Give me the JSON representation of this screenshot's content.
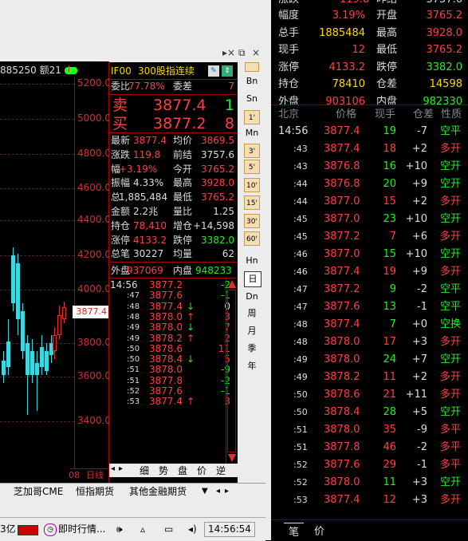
{
  "window": {
    "title_fragment": "885250 额21"
  },
  "chart": {
    "y_ticks": [
      "5200.0",
      "5000.0",
      "4800.0",
      "4600.0",
      "4400.0",
      "4200.0",
      "4000.0",
      "3800.0",
      "3600.0",
      "3400.0"
    ],
    "last_price_tag": "3877.4",
    "bottom_label": "08",
    "bottom_label2": "日线"
  },
  "quote": {
    "code": "IF00",
    "name": "300股指连续",
    "weibi_label": "委比",
    "weibi": "77.78%",
    "weicha_label": "委差",
    "weicha": "7",
    "sell_label": "卖",
    "sell_price": "3877.4",
    "sell_qty": "1",
    "buy_label": "买",
    "buy_price": "3877.2",
    "buy_qty": "8",
    "rows": [
      {
        "l1": "最新",
        "v1": "3877.4",
        "l2": "均价",
        "v2": "3869.5"
      },
      {
        "l1": "涨跌",
        "v1": "119.8",
        "l2": "前结",
        "v2": "3757.6"
      },
      {
        "l1": "幅",
        "v1": "+3.19%",
        "l2": "今开",
        "v2": "3765.2"
      },
      {
        "l1": "振幅",
        "v1": "4.33%",
        "l2": "最高",
        "v2": "3928.0"
      },
      {
        "l1": "总",
        "v1": "1,885,484",
        "l2": "最低",
        "v2": "3765.2"
      },
      {
        "l1": "金额",
        "v1": "2.2兆",
        "l2": "量比",
        "v2": "1.25"
      },
      {
        "l1": "持仓",
        "v1": "78,410",
        "l2": "增仓",
        "v2": "+14,598"
      },
      {
        "l1": "涨停",
        "v1": "4133.2",
        "l2": "跌停",
        "v2": "3382.0"
      },
      {
        "l1": "总笔",
        "v1": "30227",
        "l2": "均量",
        "v2": "62"
      }
    ],
    "outer_label": "外盘",
    "outer": "937069",
    "inner_label": "内盘",
    "inner": "948233",
    "ticks": [
      {
        "t": "14:56",
        "p": "3877.2",
        "a": "",
        "v": "-2"
      },
      {
        "t": ":47",
        "p": "3877.6",
        "a": "",
        "v": "-1"
      },
      {
        "t": ":48",
        "p": "3877.4",
        "a": "↓",
        "v": "0"
      },
      {
        "t": ":48",
        "p": "3878.0",
        "a": "↑",
        "v": "3"
      },
      {
        "t": ":49",
        "p": "3878.0",
        "a": "↓",
        "v": "7"
      },
      {
        "t": ":49",
        "p": "3878.2",
        "a": "↑",
        "v": "2"
      },
      {
        "t": ":50",
        "p": "3878.6",
        "a": "",
        "v": "11"
      },
      {
        "t": ":50",
        "p": "3878.4",
        "a": "↓",
        "v": "5"
      },
      {
        "t": ":51",
        "p": "3878.0",
        "a": "",
        "v": "-9"
      },
      {
        "t": ":51",
        "p": "3877.8",
        "a": "",
        "v": "-2"
      },
      {
        "t": ":52",
        "p": "3877.6",
        "a": "",
        "v": "-1"
      },
      {
        "t": ":53",
        "p": "3877.4",
        "a": "↑",
        "v": "3"
      }
    ],
    "bottom_tabs": [
      "细",
      "势",
      "盘",
      "价",
      "逆"
    ]
  },
  "toolbar": {
    "items": [
      "Bn",
      "Sn",
      "1'",
      "Mn",
      "3'",
      "5'",
      "10'",
      "15'",
      "30'",
      "60'",
      "Hn",
      "日",
      "Dn",
      "周",
      "月",
      "季",
      "年"
    ]
  },
  "tabs": [
    "芝加哥CME",
    "恒指期货",
    "其他金融期货"
  ],
  "status": {
    "left": "3亿",
    "news": "即时行情...",
    "time": "14:56:54"
  },
  "right": {
    "top_partial": {
      "l1": "涨跌",
      "v1": "119.8",
      "l2": "昨结",
      "v2": "3757.6"
    },
    "quote_rows": [
      {
        "l1": "幅度",
        "v1": "3.19%",
        "l2": "开盘",
        "v2": "3765.2"
      },
      {
        "l1": "总手",
        "v1": "1885484",
        "l2": "最高",
        "v2": "3928.0"
      },
      {
        "l1": "现手",
        "v1": "12",
        "l2": "最低",
        "v2": "3765.2"
      },
      {
        "l1": "涨停",
        "v1": "4133.2",
        "l2": "跌停",
        "v2": "3382.0"
      },
      {
        "l1": "持仓",
        "v1": "78410",
        "l2": "仓差",
        "v2": "14598"
      },
      {
        "l1": "外盘",
        "v1": "903106",
        "l2": "内盘",
        "v2": "982330"
      }
    ],
    "header": {
      "c1": "北京",
      "c2": "价格",
      "c3": "现手",
      "c4": "仓差",
      "c5": "性质"
    },
    "trades": [
      {
        "t": "14:56",
        "p": "3877.4",
        "q": "19",
        "d": "-7",
        "n": "空平",
        "nc": "grn"
      },
      {
        "t": ":43",
        "p": "3877.4",
        "q": "18",
        "d": "+2",
        "n": "多开",
        "nc": "red"
      },
      {
        "t": ":43",
        "p": "3876.8",
        "q": "16",
        "d": "+10",
        "n": "空开",
        "nc": "grn"
      },
      {
        "t": ":44",
        "p": "3876.8",
        "q": "20",
        "d": "+9",
        "n": "空开",
        "nc": "grn"
      },
      {
        "t": ":44",
        "p": "3877.0",
        "q": "15",
        "d": "+2",
        "n": "多开",
        "nc": "red"
      },
      {
        "t": ":45",
        "p": "3877.0",
        "q": "23",
        "d": "+10",
        "n": "空开",
        "nc": "grn"
      },
      {
        "t": ":45",
        "p": "3877.2",
        "q": "7",
        "d": "+6",
        "n": "多开",
        "nc": "red"
      },
      {
        "t": ":46",
        "p": "3877.0",
        "q": "15",
        "d": "+10",
        "n": "空开",
        "nc": "grn"
      },
      {
        "t": ":46",
        "p": "3877.4",
        "q": "19",
        "d": "+9",
        "n": "多开",
        "nc": "red"
      },
      {
        "t": ":47",
        "p": "3877.2",
        "q": "9",
        "d": "-2",
        "n": "空平",
        "nc": "grn"
      },
      {
        "t": ":47",
        "p": "3877.6",
        "q": "13",
        "d": "-1",
        "n": "空平",
        "nc": "grn"
      },
      {
        "t": ":48",
        "p": "3877.4",
        "q": "7",
        "d": "+0",
        "n": "空换",
        "nc": "grn"
      },
      {
        "t": ":48",
        "p": "3878.0",
        "q": "17",
        "d": "+3",
        "n": "多开",
        "nc": "red"
      },
      {
        "t": ":49",
        "p": "3878.0",
        "q": "24",
        "d": "+7",
        "n": "空开",
        "nc": "grn"
      },
      {
        "t": ":49",
        "p": "3878.2",
        "q": "11",
        "d": "+2",
        "n": "多开",
        "nc": "red"
      },
      {
        "t": ":50",
        "p": "3878.6",
        "q": "21",
        "d": "+11",
        "n": "多开",
        "nc": "red"
      },
      {
        "t": ":50",
        "p": "3878.4",
        "q": "28",
        "d": "+5",
        "n": "空开",
        "nc": "grn"
      },
      {
        "t": ":51",
        "p": "3878.0",
        "q": "35",
        "d": "-9",
        "n": "多平",
        "nc": "red"
      },
      {
        "t": ":51",
        "p": "3877.8",
        "q": "46",
        "d": "-2",
        "n": "多平",
        "nc": "red"
      },
      {
        "t": ":52",
        "p": "3877.6",
        "q": "29",
        "d": "-1",
        "n": "多平",
        "nc": "red"
      },
      {
        "t": ":52",
        "p": "3878.0",
        "q": "11",
        "d": "+3",
        "n": "空开",
        "nc": "grn"
      },
      {
        "t": ":53",
        "p": "3877.4",
        "q": "12",
        "d": "+3",
        "n": "多开",
        "nc": "red"
      }
    ],
    "bottom_tabs": [
      "笔",
      "价"
    ]
  }
}
